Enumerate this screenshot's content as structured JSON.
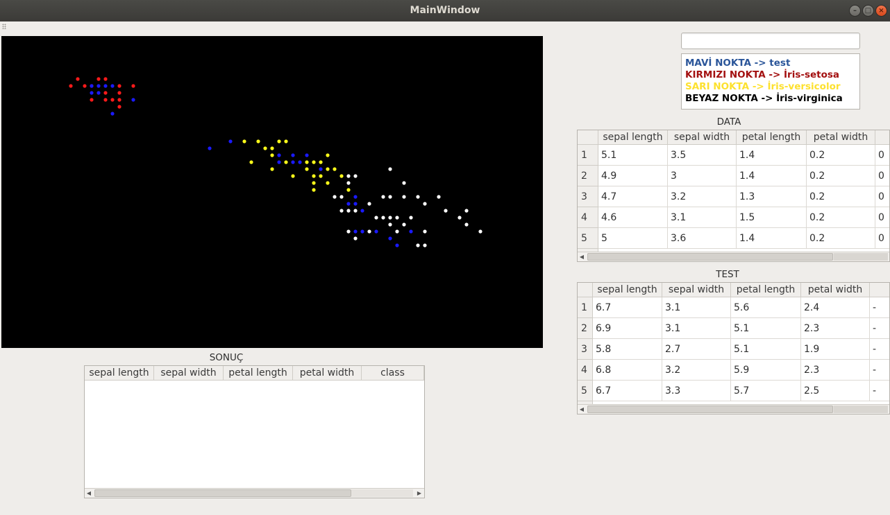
{
  "window": {
    "title": "MainWindow"
  },
  "legend": {
    "items": [
      {
        "label": "MAVİ NOKTA -> test",
        "color": "#2a5599"
      },
      {
        "label": "KIRMIZI NOKTA ->  İris-setosa",
        "color": "#a31010"
      },
      {
        "label": "SARI NOKTA -> İris-versicolor",
        "color": "#fde12e"
      },
      {
        "label": "BEYAZ NOKTA -> İris-virginica",
        "color": "#000000"
      }
    ]
  },
  "data_table": {
    "title": "DATA",
    "columns": [
      "sepal length",
      "sepal width",
      "petal length",
      "petal width"
    ],
    "rows": [
      {
        "n": "1",
        "cells": [
          "5.1",
          "3.5",
          "1.4",
          "0.2",
          "0"
        ]
      },
      {
        "n": "2",
        "cells": [
          "4.9",
          "3",
          "1.4",
          "0.2",
          "0"
        ]
      },
      {
        "n": "3",
        "cells": [
          "4.7",
          "3.2",
          "1.3",
          "0.2",
          "0"
        ]
      },
      {
        "n": "4",
        "cells": [
          "4.6",
          "3.1",
          "1.5",
          "0.2",
          "0"
        ]
      },
      {
        "n": "5",
        "cells": [
          "5",
          "3.6",
          "1.4",
          "0.2",
          "0"
        ]
      }
    ]
  },
  "test_table": {
    "title": "TEST",
    "columns": [
      "sepal length",
      "sepal width",
      "petal length",
      "petal width"
    ],
    "rows": [
      {
        "n": "1",
        "cells": [
          "6.7",
          "3.1",
          "5.6",
          "2.4",
          "-"
        ]
      },
      {
        "n": "2",
        "cells": [
          "6.9",
          "3.1",
          "5.1",
          "2.3",
          "-"
        ]
      },
      {
        "n": "3",
        "cells": [
          "5.8",
          "2.7",
          "5.1",
          "1.9",
          "-"
        ]
      },
      {
        "n": "4",
        "cells": [
          "6.8",
          "3.2",
          "5.9",
          "2.3",
          "-"
        ]
      },
      {
        "n": "5",
        "cells": [
          "6.7",
          "3.3",
          "5.7",
          "2.5",
          "-"
        ]
      }
    ]
  },
  "result_table": {
    "title": "SONUÇ",
    "columns": [
      "sepal length",
      "sepal width",
      "petal length",
      "petal width",
      "class"
    ]
  },
  "plot": {
    "background": "#000000",
    "colors": {
      "red": "#ff1a1a",
      "blue": "#1a1aff",
      "yellow": "#ffff1a",
      "white": "#ffffff"
    },
    "points": {
      "red": [
        [
          110,
          62
        ],
        [
          140,
          62
        ],
        [
          150,
          62
        ],
        [
          100,
          72
        ],
        [
          120,
          72
        ],
        [
          130,
          72
        ],
        [
          170,
          72
        ],
        [
          190,
          72
        ],
        [
          150,
          82
        ],
        [
          170,
          82
        ],
        [
          130,
          92
        ],
        [
          150,
          92
        ],
        [
          160,
          92
        ],
        [
          170,
          92
        ],
        [
          170,
          102
        ]
      ],
      "blue": [
        [
          130,
          72
        ],
        [
          140,
          72
        ],
        [
          150,
          72
        ],
        [
          160,
          72
        ],
        [
          130,
          82
        ],
        [
          140,
          82
        ],
        [
          190,
          92
        ],
        [
          160,
          112
        ],
        [
          300,
          162
        ],
        [
          330,
          152
        ],
        [
          400,
          172
        ],
        [
          420,
          172
        ],
        [
          440,
          172
        ],
        [
          460,
          192
        ],
        [
          400,
          182
        ],
        [
          420,
          182
        ],
        [
          430,
          182
        ],
        [
          510,
          232
        ],
        [
          500,
          242
        ],
        [
          510,
          242
        ],
        [
          520,
          252
        ],
        [
          510,
          282
        ],
        [
          520,
          282
        ],
        [
          540,
          282
        ],
        [
          590,
          282
        ],
        [
          560,
          292
        ],
        [
          570,
          302
        ]
      ],
      "yellow": [
        [
          350,
          152
        ],
        [
          370,
          152
        ],
        [
          400,
          152
        ],
        [
          410,
          152
        ],
        [
          380,
          162
        ],
        [
          390,
          162
        ],
        [
          390,
          172
        ],
        [
          360,
          182
        ],
        [
          410,
          182
        ],
        [
          440,
          182
        ],
        [
          450,
          182
        ],
        [
          460,
          182
        ],
        [
          470,
          172
        ],
        [
          390,
          192
        ],
        [
          440,
          192
        ],
        [
          470,
          192
        ],
        [
          480,
          192
        ],
        [
          420,
          202
        ],
        [
          450,
          202
        ],
        [
          460,
          202
        ],
        [
          490,
          202
        ],
        [
          450,
          212
        ],
        [
          470,
          212
        ],
        [
          450,
          222
        ],
        [
          500,
          222
        ]
      ],
      "white": [
        [
          560,
          192
        ],
        [
          500,
          202
        ],
        [
          510,
          202
        ],
        [
          580,
          212
        ],
        [
          500,
          212
        ],
        [
          480,
          232
        ],
        [
          490,
          232
        ],
        [
          530,
          242
        ],
        [
          550,
          232
        ],
        [
          560,
          232
        ],
        [
          580,
          232
        ],
        [
          600,
          232
        ],
        [
          630,
          232
        ],
        [
          610,
          242
        ],
        [
          490,
          252
        ],
        [
          500,
          252
        ],
        [
          510,
          252
        ],
        [
          640,
          252
        ],
        [
          670,
          252
        ],
        [
          540,
          262
        ],
        [
          550,
          262
        ],
        [
          560,
          262
        ],
        [
          570,
          262
        ],
        [
          590,
          262
        ],
        [
          660,
          262
        ],
        [
          560,
          272
        ],
        [
          580,
          272
        ],
        [
          670,
          272
        ],
        [
          500,
          282
        ],
        [
          530,
          282
        ],
        [
          570,
          282
        ],
        [
          610,
          282
        ],
        [
          690,
          282
        ],
        [
          510,
          292
        ],
        [
          600,
          302
        ],
        [
          610,
          302
        ]
      ]
    }
  }
}
